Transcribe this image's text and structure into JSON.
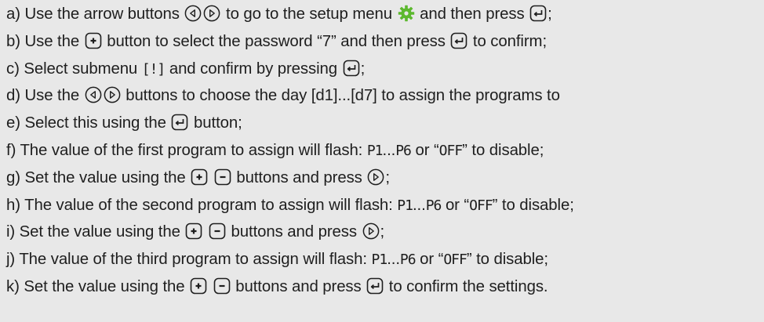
{
  "steps": [
    [
      "a) Use the arrow buttons ",
      "{left}",
      "{right}",
      " to go to the setup menu ",
      "{gear}",
      " and then press ",
      "{enter}",
      ";"
    ],
    [
      "b) Use the ",
      "{plus}",
      " button to select the password “7” and then press ",
      "{enter}",
      " to confirm;"
    ],
    [
      "c) Select submenu ",
      "{seg:[!]}",
      " and confirm by pressing ",
      "{enter}",
      ";"
    ],
    [
      "d) Use the  ",
      "{left}",
      "{right}",
      " buttons to choose the day [d1]...[d7] to assign the programs to"
    ],
    [
      "e) Select this using the ",
      "{enter}",
      " button;"
    ],
    [
      "f)  The value of the first program to assign will flash: ",
      "{seg:P1}",
      "...",
      "{seg:P6}",
      " or “",
      "{seg:OFF}",
      "” to disable;"
    ],
    [
      "g) Set the value using the ",
      "{plus}",
      " ",
      "{minus}",
      " buttons and press ",
      "{right}",
      ";"
    ],
    [
      "h) The value of the second program to assign will flash: ",
      "{seg:P1}",
      "...",
      "{seg:P6}",
      " or “",
      "{seg:OFF}",
      "” to disable;"
    ],
    [
      "i)  Set the value using the ",
      "{plus}",
      " ",
      "{minus}",
      " buttons and press ",
      "{right}",
      ";"
    ],
    [
      "j)  The value of the third program to assign will flash: ",
      "{seg:P1}",
      "...",
      "{seg:P6}",
      " or “",
      "{seg:OFF}",
      "” to disable;"
    ],
    [
      "k) Set the value using the ",
      "{plus}",
      " ",
      "{minus}",
      " buttons and press ",
      "{enter}",
      " to confirm the settings."
    ]
  ],
  "colors": {
    "background": "#e8e8e8",
    "text": "#1e1e1e",
    "gear_icon": "#5cb82e",
    "icon_stroke": "#1e1e1e"
  },
  "icons": {
    "left": "arrow-left-circle-icon",
    "right": "arrow-right-circle-icon",
    "gear": "setup-gear-icon",
    "enter": "enter-key-icon",
    "plus": "plus-key-icon",
    "minus": "minus-key-icon"
  }
}
